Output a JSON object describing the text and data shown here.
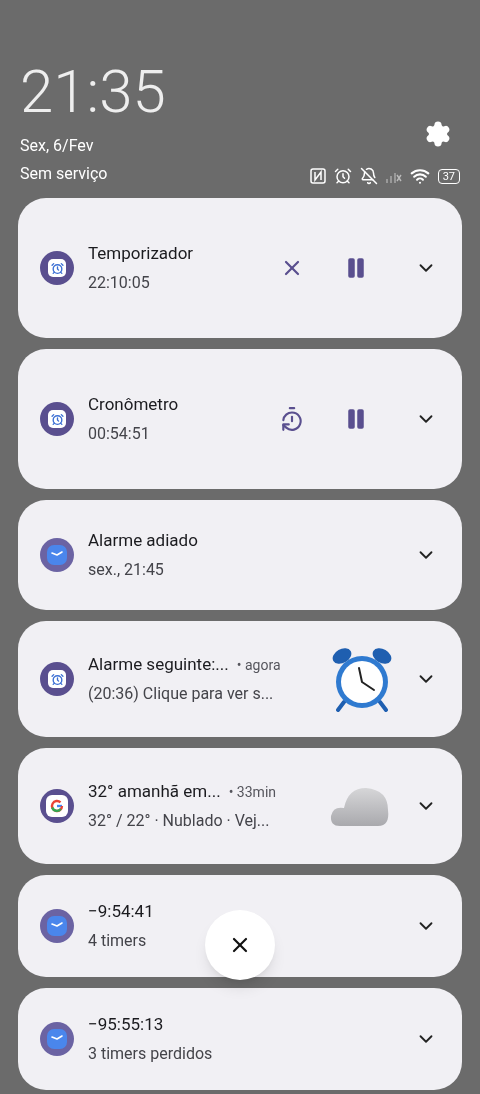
{
  "header": {
    "time": "21:35",
    "date": "Sex, 6/Fev",
    "carrier": "Sem serviço",
    "battery": "37"
  },
  "notifications": [
    {
      "kind": "action",
      "app_icon": {
        "kind": "alarm"
      },
      "title": "Temporizador",
      "subtitle": "22:10:05",
      "actions": [
        {
          "kind": "cancel"
        },
        {
          "kind": "pause"
        }
      ]
    },
    {
      "kind": "action",
      "app_icon": {
        "kind": "alarm"
      },
      "title": "Cronômetro",
      "subtitle": "00:54:51",
      "actions": [
        {
          "kind": "lap"
        },
        {
          "kind": "pause"
        }
      ]
    },
    {
      "kind": "plain",
      "app_icon": {
        "kind": "clock"
      },
      "title": "Alarme adiado",
      "subtitle": "sex., 21:45"
    },
    {
      "kind": "image",
      "app_icon": {
        "kind": "alarm"
      },
      "title": "Alarme seguinte:...",
      "time": "• agora",
      "subtitle": "(20:36) Clique para ver s...",
      "image": {
        "kind": "alarm-clock"
      }
    },
    {
      "kind": "image",
      "app_icon": {
        "kind": "google"
      },
      "title": "32° amanhã em...",
      "time": "• 33min",
      "subtitle": "32° / 22° · Nublado · Vej...",
      "image": {
        "kind": "cloud"
      }
    },
    {
      "kind": "plain",
      "app_icon": {
        "kind": "clock"
      },
      "title": "−9:54:41",
      "subtitle": "4 timers"
    },
    {
      "kind": "plain",
      "app_icon": {
        "kind": "clock"
      },
      "title": "−95:55:13",
      "subtitle": "3 timers perdidos"
    }
  ]
}
